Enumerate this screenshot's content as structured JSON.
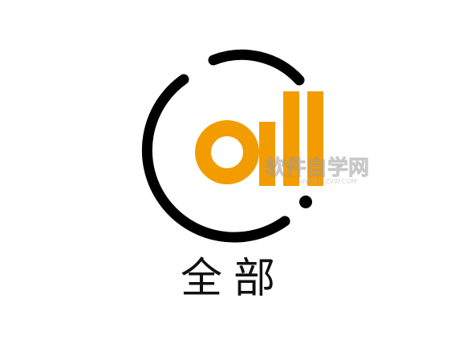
{
  "logo": {
    "text": "all",
    "accent_color": "#f39c00",
    "ring_color": "#000000"
  },
  "caption": "全部",
  "watermark": {
    "title": "软件自学网",
    "url": "WWW.RJZXW.COM"
  }
}
